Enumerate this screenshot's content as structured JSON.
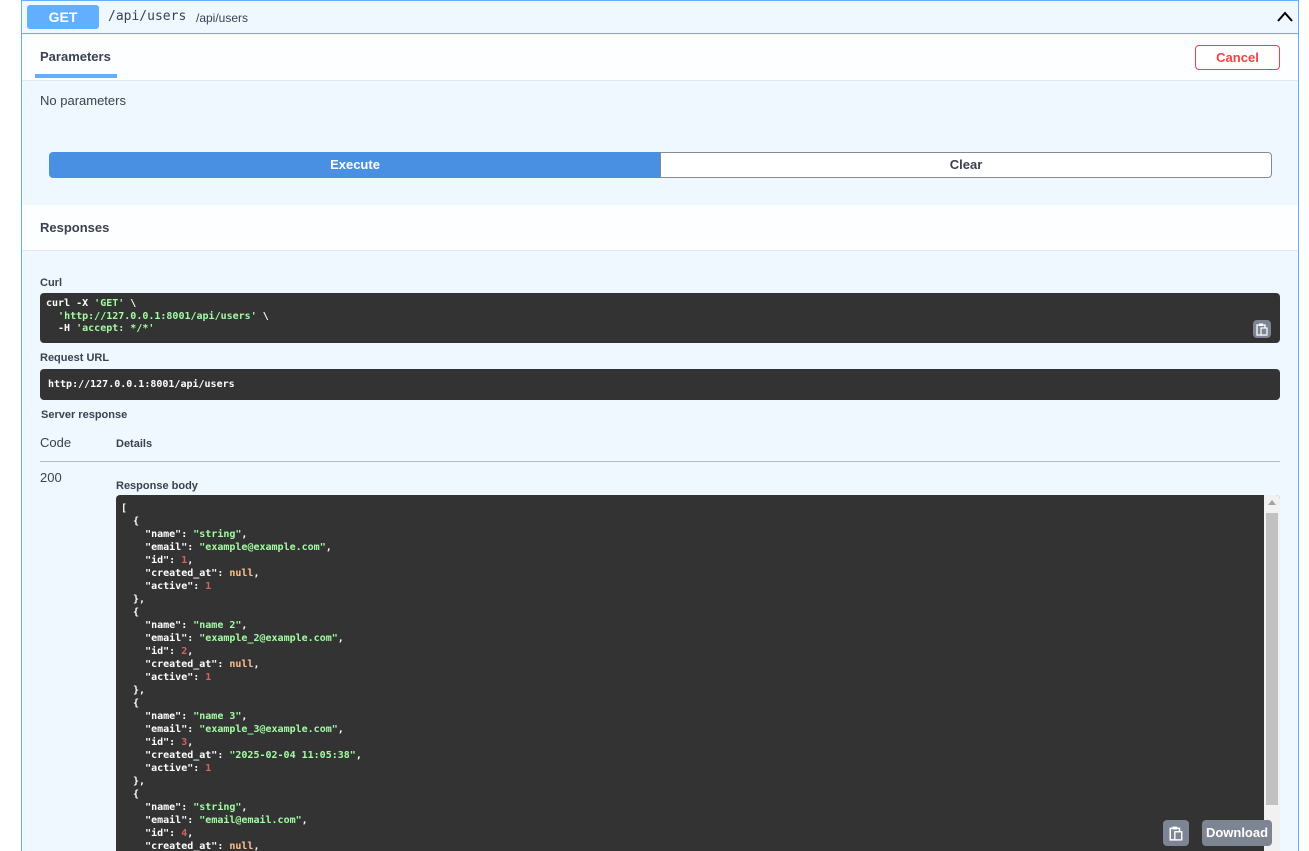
{
  "operation": {
    "method": "GET",
    "path": "/api/users",
    "path_description": "/api/users"
  },
  "tabs": {
    "parameters_label": "Parameters",
    "cancel_label": "Cancel",
    "no_parameters_text": "No parameters"
  },
  "actions": {
    "execute_label": "Execute",
    "clear_label": "Clear"
  },
  "responses": {
    "title": "Responses",
    "curl_label": "Curl",
    "curl_line1_cmd": "curl -X ",
    "curl_line1_method": "'GET'",
    "curl_line1_tail": " \\",
    "curl_line2_url": "'http://127.0.0.1:8001/api/users'",
    "curl_line2_tail": " \\",
    "curl_line3_flag": "  -H ",
    "curl_line3_header": "'accept: */*'",
    "request_url_label": "Request URL",
    "request_url": "http://127.0.0.1:8001/api/users",
    "server_response_label": "Server response",
    "code_header": "Code",
    "details_header": "Details",
    "status_code": "200",
    "response_body_label": "Response body",
    "download_label": "Download"
  },
  "response_body": [
    {
      "name": "string",
      "email": "example@example.com",
      "id": "1",
      "created_at": "null",
      "active": "1"
    },
    {
      "name": "name 2",
      "email": "example_2@example.com",
      "id": "2",
      "created_at": "null",
      "active": "1"
    },
    {
      "name": "name 3",
      "email": "example_3@example.com",
      "id": "3",
      "created_at": "\"2025-02-04 11:05:38\"",
      "active": "1"
    },
    {
      "name": "string",
      "email": "email@email.com",
      "id": "4",
      "created_at": "null"
    }
  ],
  "colors": {
    "get_blue": "#61affe",
    "execute_blue": "#4990e2",
    "cancel_red": "#f93e3e",
    "code_bg": "#333333",
    "json_string": "#a2fca2",
    "json_number": "#d36363",
    "json_null": "#fcc28c"
  },
  "icons": {
    "collapse": "chevron-up-icon",
    "copy": "clipboard-icon"
  }
}
